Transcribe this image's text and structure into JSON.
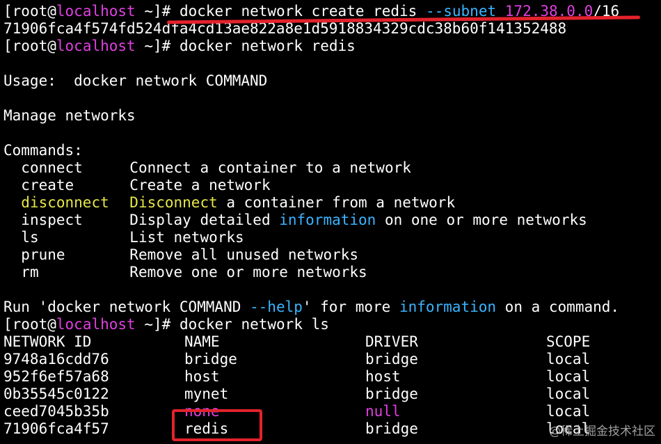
{
  "prompt": {
    "user": "root",
    "host": "localhost",
    "dir": "~",
    "open": "[",
    "at": "@",
    "close": "]#"
  },
  "cmd1": {
    "base": "docker network create redis ",
    "flag": "--subnet",
    "space": " ",
    "ip": "172.38.0.0",
    "suffix": "/16"
  },
  "net_id_full": "71906fca4f574fd524dfa4cd13ae822a8e1d5918834329cdc38b60f141352488",
  "cmd2": "docker network redis",
  "usage": "Usage:  docker network COMMAND",
  "manage": "Manage networks",
  "commands_header": "Commands:",
  "commands": [
    {
      "name": "connect",
      "desc": "Connect a container to a network"
    },
    {
      "name": "create",
      "desc": "Create a network"
    },
    {
      "name": "disconnect",
      "desc_hl": "Disconnect",
      "desc": " a container from a network"
    },
    {
      "name": "inspect",
      "desc_a": "Display detailed ",
      "desc_hl": "information",
      "desc_b": " on one or more networks"
    },
    {
      "name": "ls",
      "desc": "List networks"
    },
    {
      "name": "prune",
      "desc": "Remove all unused networks"
    },
    {
      "name": "rm",
      "desc": "Remove one or more networks"
    }
  ],
  "help": {
    "a": "Run 'docker network COMMAND ",
    "flag": "--help",
    "b": "' for more ",
    "info": "information",
    "c": " on a command."
  },
  "cmd3": "docker network ls",
  "table": {
    "headers": [
      "NETWORK ID",
      "NAME",
      "DRIVER",
      "SCOPE"
    ],
    "rows": [
      [
        "9748a16cdd76",
        "bridge",
        "bridge",
        "local"
      ],
      [
        "952f6ef57a68",
        "host",
        "host",
        "local"
      ],
      [
        "0b35545c0122",
        "mynet",
        "bridge",
        "local"
      ],
      [
        "ceed7045b35b",
        "none",
        "null",
        "local"
      ],
      [
        "71906fca4f57",
        "redis",
        "bridge",
        "local"
      ]
    ]
  },
  "watermark": "@稀土掘金技术社区",
  "colors": {
    "accent_red": "#e3222c",
    "host_magenta": "#e040e0",
    "flag_blue": "#3ab4ff",
    "highlight_yellow": "#e8e84a"
  }
}
